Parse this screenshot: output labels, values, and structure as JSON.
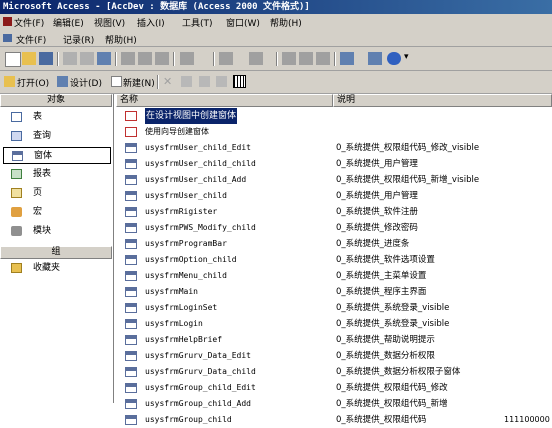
{
  "window": {
    "title": "Microsoft Access - [AccDev : 数据库 (Access 2000 文件格式)]"
  },
  "menubar": {
    "items": [
      "文件(F)",
      "编辑(E)",
      "视图(V)",
      "插入(I)",
      "工具(T)",
      "窗口(W)",
      "帮助(H)"
    ]
  },
  "toolbar2": {
    "items": [
      "文件(F)",
      "记录(R)",
      "帮助(H)"
    ]
  },
  "dbwindow_toolbar": {
    "open_label": "打开(O)",
    "design_label": "设计(D)",
    "new_label": "新建(N)"
  },
  "sidebar": {
    "objects_header": "对象",
    "items": [
      {
        "label": "表",
        "icon": "table-icon"
      },
      {
        "label": "查询",
        "icon": "query-icon"
      },
      {
        "label": "窗体",
        "icon": "form-icon"
      },
      {
        "label": "报表",
        "icon": "report-icon"
      },
      {
        "label": "页",
        "icon": "page-icon"
      },
      {
        "label": "宏",
        "icon": "macro-icon"
      },
      {
        "label": "模块",
        "icon": "module-icon"
      }
    ],
    "groups_header": "组",
    "group_items": [
      {
        "label": "收藏夹",
        "icon": "favorites-folder-icon"
      }
    ]
  },
  "list": {
    "columns": [
      "名称",
      "说明"
    ],
    "rows": [
      {
        "name": "在设计视图中创建窗体",
        "desc": "",
        "extra": ""
      },
      {
        "name": "使用向导创建窗体",
        "desc": "",
        "extra": ""
      },
      {
        "name": "usysfrmUser_child_Edit",
        "desc": "0_系统提供_权限组代码_修改_visible",
        "extra": ""
      },
      {
        "name": "usysfrmUser_child_child",
        "desc": "0_系统提供_用户管理",
        "extra": ""
      },
      {
        "name": "usysfrmUser_child_Add",
        "desc": "0_系统提供_权限组代码_新增_visible",
        "extra": ""
      },
      {
        "name": "usysfrmUser_child",
        "desc": "0_系统提供_用户管理",
        "extra": ""
      },
      {
        "name": "usysfrmRigister",
        "desc": "0_系统提供_软件注册",
        "extra": ""
      },
      {
        "name": "usysfrmPWS_Modify_child",
        "desc": "0_系统提供_修改密码",
        "extra": ""
      },
      {
        "name": "usysfrmProgramBar",
        "desc": "0_系统提供_进度条",
        "extra": ""
      },
      {
        "name": "usysfrmOption_child",
        "desc": "0_系统提供_软件选项设置",
        "extra": ""
      },
      {
        "name": "usysfrmMenu_child",
        "desc": "0_系统提供_主菜单设置",
        "extra": ""
      },
      {
        "name": "usysfrmMain",
        "desc": "0_系统提供_程序主界面",
        "extra": ""
      },
      {
        "name": "usysfrmLoginSet",
        "desc": "0_系统提供_系统登录_visible",
        "extra": ""
      },
      {
        "name": "usysfrmLogin",
        "desc": "0_系统提供_系统登录_visible",
        "extra": ""
      },
      {
        "name": "usysfrmHelpBrief",
        "desc": "0_系统提供_帮助说明提示",
        "extra": ""
      },
      {
        "name": "usysfrmGrurv_Data_Edit",
        "desc": "0_系统提供_数据分析权限",
        "extra": ""
      },
      {
        "name": "usysfrmGrurv_Data_child",
        "desc": "0_系统提供_数据分析权限子窗体",
        "extra": ""
      },
      {
        "name": "usysfrmGroup_child_Edit",
        "desc": "0_系统提供_权限组代码_修改",
        "extra": ""
      },
      {
        "name": "usysfrmGroup_child_Add",
        "desc": "0_系统提供_权限组代码_新增",
        "extra": ""
      },
      {
        "name": "usysfrmGroup_child",
        "desc": "0_系统提供_权限组代码",
        "extra": "111100000"
      }
    ]
  },
  "colors": {
    "title_bg": "#0a246a",
    "face": "#d4d0c8",
    "selection": "#0a246a"
  }
}
